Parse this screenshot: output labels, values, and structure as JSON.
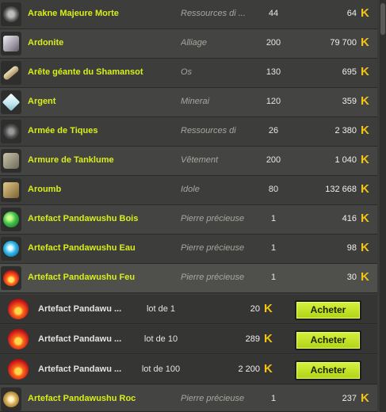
{
  "currency_symbol": "K",
  "items": [
    {
      "name": "Arakne Majeure Morte",
      "type": "Ressources di ...",
      "level": "44",
      "price": "64",
      "icon": "arakne-icon",
      "icon_color": "#8a8a8a"
    },
    {
      "name": "Ardonite",
      "type": "Alliage",
      "level": "200",
      "price": "79 700",
      "icon": "ardonite-icon",
      "icon_color": "#c8c4cc"
    },
    {
      "name": "Arête géante du Shamansot",
      "type": "Os",
      "level": "130",
      "price": "695",
      "icon": "bone-icon",
      "icon_color": "#d8c79c"
    },
    {
      "name": "Argent",
      "type": "Minerai",
      "level": "120",
      "price": "359",
      "icon": "silver-ore-icon",
      "icon_color": "#e6f2f6"
    },
    {
      "name": "Armée de Tiques",
      "type": "Ressources di",
      "level": "26",
      "price": "2 380",
      "icon": "ticks-icon",
      "icon_color": "#6c6c6c"
    },
    {
      "name": "Armure de Tanklume",
      "type": "Vêtement",
      "level": "200",
      "price": "1 040",
      "icon": "armor-icon",
      "icon_color": "#9a9682"
    },
    {
      "name": "Aroumb",
      "type": "Idole",
      "level": "80",
      "price": "132 668",
      "icon": "idol-icon",
      "icon_color": "#b59a5a"
    },
    {
      "name": "Artefact Pandawushu Bois",
      "type": "Pierre précieuse",
      "level": "1",
      "price": "416",
      "icon": "wood-artefact-icon",
      "icon_color": "#3fbf4a"
    },
    {
      "name": "Artefact Pandawushu Eau",
      "type": "Pierre précieuse",
      "level": "1",
      "price": "98",
      "icon": "water-artefact-icon",
      "icon_color": "#2fb6e8"
    },
    {
      "name": "Artefact Pandawushu Feu",
      "type": "Pierre précieuse",
      "level": "1",
      "price": "30",
      "icon": "fire-artefact-icon",
      "icon_color": "#e8391a"
    }
  ],
  "lots": [
    {
      "name": "Artefact Pandawu ...",
      "size": "lot de 1",
      "price": "20",
      "button": "Acheter"
    },
    {
      "name": "Artefact Pandawu ...",
      "size": "lot de 10",
      "price": "289",
      "button": "Acheter"
    },
    {
      "name": "Artefact Pandawu ...",
      "size": "lot de 100",
      "price": "2 200",
      "button": "Acheter"
    }
  ],
  "last_item": {
    "name": "Artefact Pandawushu Roc",
    "type": "Pierre précieuse",
    "level": "1",
    "price": "237",
    "icon": "rock-artefact-icon",
    "icon_color": "#d8b05a"
  }
}
